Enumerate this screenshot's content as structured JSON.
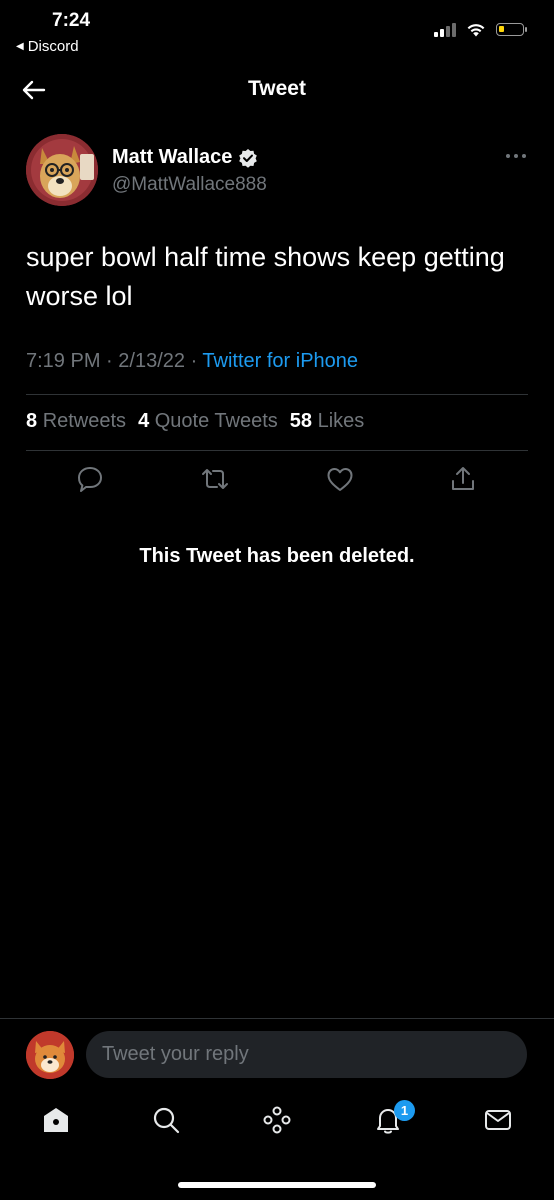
{
  "status_bar": {
    "time": "7:24",
    "back_app": "Discord",
    "battery_level": 0.25
  },
  "header": {
    "title": "Tweet"
  },
  "tweet": {
    "author_name": "Matt Wallace",
    "author_handle": "@MattWallace888",
    "text": "super bowl half time shows keep getting worse lol",
    "time": "7:19 PM",
    "date": "2/13/22",
    "source": "Twitter for iPhone",
    "stats": {
      "retweets_count": "8",
      "retweets_label": "Retweets",
      "quotes_count": "4",
      "quotes_label": "Quote Tweets",
      "likes_count": "58",
      "likes_label": "Likes"
    },
    "deleted_notice": "This Tweet has been deleted."
  },
  "reply": {
    "placeholder": "Tweet your reply"
  },
  "nav": {
    "notifications_badge": "1",
    "items": [
      "home-icon",
      "search-icon",
      "spaces-icon",
      "notifications-icon",
      "messages-icon"
    ]
  },
  "colors": {
    "background": "#000000",
    "accent": "#1d9bf0",
    "secondary_text": "#71767b",
    "divider": "#2f3336"
  }
}
